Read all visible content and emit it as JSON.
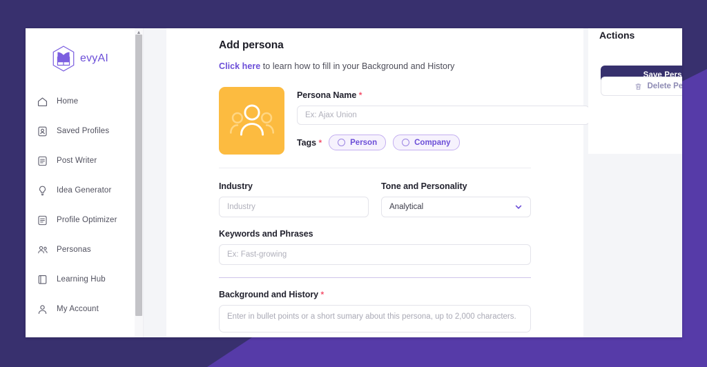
{
  "theme": {
    "brand_purple": "#6c4fd8",
    "dark_purple": "#38306e",
    "accent_purple": "#563ba8",
    "avatar_yellow": "#fcbb40",
    "required_red": "#f4516c"
  },
  "sidebar": {
    "logo_text": "evyAI",
    "items": [
      {
        "label": "Home",
        "icon": "home-icon"
      },
      {
        "label": "Saved Profiles",
        "icon": "saved-profiles-icon"
      },
      {
        "label": "Post Writer",
        "icon": "post-writer-icon"
      },
      {
        "label": "Idea Generator",
        "icon": "idea-generator-icon"
      },
      {
        "label": "Profile Optimizer",
        "icon": "profile-optimizer-icon"
      },
      {
        "label": "Personas",
        "icon": "personas-icon"
      },
      {
        "label": "Learning Hub",
        "icon": "learning-hub-icon"
      },
      {
        "label": "My Account",
        "icon": "my-account-icon"
      }
    ]
  },
  "main": {
    "title": "Add persona",
    "subtitle_link": "Click here",
    "subtitle_rest": " to learn how to fill in your Background and History",
    "avatar_icon": "people-group-icon",
    "persona_name": {
      "label": "Persona Name",
      "required_mark": "*",
      "value": "",
      "placeholder": "Ex: Ajax Union"
    },
    "tags": {
      "label": "Tags",
      "required_mark": "*",
      "options": [
        {
          "label": "Person",
          "selected": false
        },
        {
          "label": "Company",
          "selected": false
        }
      ]
    },
    "industry": {
      "label": "Industry",
      "value": "",
      "placeholder": "Industry"
    },
    "tone": {
      "label": "Tone and Personality",
      "value": "Analytical",
      "chevron": "chevron-down-icon"
    },
    "keywords": {
      "label": "Keywords and Phrases",
      "value": "",
      "placeholder": "Ex: Fast-growing"
    },
    "background": {
      "label": "Background and History",
      "required_mark": "*",
      "value": "",
      "placeholder": "Enter in bullet points or a short sumary about this persona, up to 2,000 characters."
    }
  },
  "actions": {
    "title": "Actions",
    "save_label": "Save Persona",
    "delete_label": "Delete Persona",
    "delete_icon": "trash-icon"
  }
}
